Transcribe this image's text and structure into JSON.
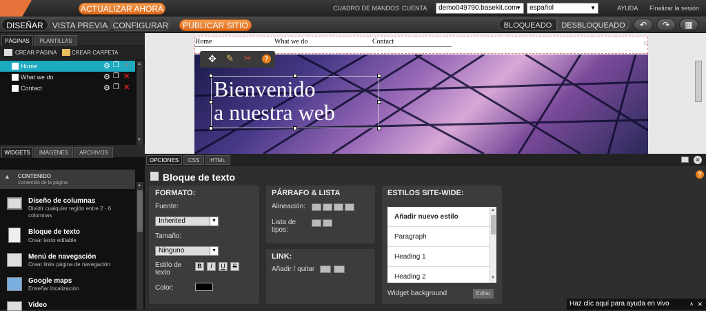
{
  "topbar": {
    "update_button": "ACTUALIZAR AHORA",
    "dashboard_link": "CUADRO DE MANDOS",
    "account_link": "CUENTA",
    "site_select": "demo049790.basekit.com",
    "language_select": "español",
    "help_link": "AYUDA",
    "logout_link": "Finalizar la sesión"
  },
  "navbar": {
    "tabs": [
      "DISEÑAR",
      "VISTA PREVIA",
      "CONFIGURAR"
    ],
    "publish_button": "PUBLICAR SITIO",
    "locked": "BLOQUEADO",
    "unlocked": "DESBLOQUEADO"
  },
  "left_panel": {
    "tabs": [
      "PÁGINAS",
      "PLANTILLAS"
    ],
    "create_page": "CREAR PÁGINA",
    "create_folder": "CREAR CARPETA",
    "pages": [
      "Home",
      "What we do",
      "Contact"
    ],
    "widget_tabs": [
      "WIDGETS",
      "IMÁGENES",
      "ARCHIVOS"
    ],
    "category_title": "CONTENIDO",
    "category_sub": "Contenido de la página",
    "widgets": [
      {
        "title": "Diseño de columnas",
        "sub": "Dividir cualquier región entre 2 - 6 columnas"
      },
      {
        "title": "Bloque de texto",
        "sub": "Crear texto editable"
      },
      {
        "title": "Menú de navegación",
        "sub": "Crear links página de navegación"
      },
      {
        "title": "Google maps",
        "sub": "Enseñar localización"
      },
      {
        "title": "Video",
        "sub": ""
      }
    ]
  },
  "canvas": {
    "menu": [
      "Home",
      "What we do",
      "Contact"
    ],
    "heading_line1": "Bienvenido",
    "heading_line2": "a nuestra web"
  },
  "bottom_panel": {
    "tabs": [
      "OPCIONES",
      "CSS",
      "HTML"
    ],
    "title": "Bloque de texto",
    "format": {
      "title": "FORMATO:",
      "font_label": "Fuente:",
      "font_value": "Inherited",
      "size_label": "Tamaño:",
      "size_value": "Ninguno",
      "style_label": "Estilo de texto",
      "style_buttons": [
        "B",
        "I",
        "U",
        "S"
      ],
      "color_label": "Color:",
      "color_value": "#000000"
    },
    "paragraph": {
      "title": "PÁRRAFO & LISTA",
      "align_label": "Alineación:",
      "list_label": "Lista de tipos:"
    },
    "link": {
      "title": "LINK:",
      "add_remove": "Añadir / quitar"
    },
    "styles": {
      "title": "ESTILOS SITE-WIDE:",
      "items": [
        "Añadir nuevo estilo",
        "Paragraph",
        "Heading 1",
        "Heading 2"
      ],
      "widget_bg": "Widget background",
      "edit_button": "Editar"
    }
  },
  "help_bar": {
    "text": "Haz clic aquí para ayuda en vivo"
  }
}
